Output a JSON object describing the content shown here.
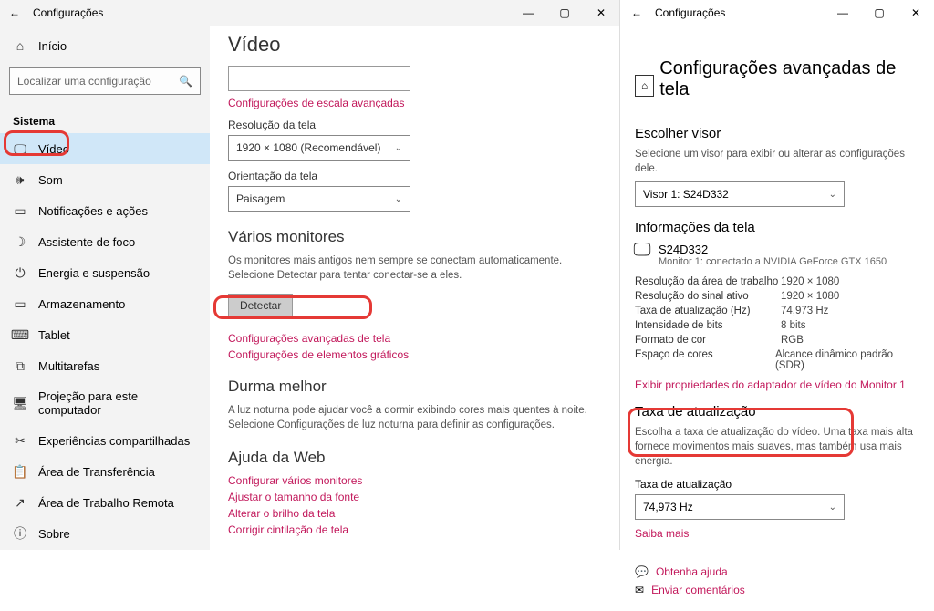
{
  "leftWindow": {
    "title": "Configurações",
    "home": "Início",
    "searchPlaceholder": "Localizar uma configuração",
    "sectionLabel": "Sistema",
    "nav": [
      {
        "label": "Vídeo",
        "icon": "🖵"
      },
      {
        "label": "Som",
        "icon": "🔊"
      },
      {
        "label": "Notificações e ações",
        "icon": "💬"
      },
      {
        "label": "Assistente de foco",
        "icon": "🌙"
      },
      {
        "label": "Energia e suspensão",
        "icon": "⏻"
      },
      {
        "label": "Armazenamento",
        "icon": "▭"
      },
      {
        "label": "Tablet",
        "icon": "⌨"
      },
      {
        "label": "Multitarefas",
        "icon": "⧉"
      },
      {
        "label": "Projeção para este computador",
        "icon": "🖥"
      },
      {
        "label": "Experiências compartilhadas",
        "icon": "⚙"
      },
      {
        "label": "Área de Transferência",
        "icon": "📋"
      },
      {
        "label": "Área de Trabalho Remota",
        "icon": "🖧"
      },
      {
        "label": "Sobre",
        "icon": "ⓘ"
      }
    ],
    "content": {
      "heading": "Vídeo",
      "advScaleLink": "Configurações de escala avançadas",
      "resLabel": "Resolução da tela",
      "resValue": "1920 × 1080 (Recomendável)",
      "orientLabel": "Orientação da tela",
      "orientValue": "Paisagem",
      "multiHeading": "Vários monitores",
      "multiDesc": "Os monitores mais antigos nem sempre se conectam automaticamente. Selecione Detectar para tentar conectar-se a eles.",
      "detectBtn": "Detectar",
      "advDisplayLink": "Configurações avançadas de tela",
      "graphicsLink": "Configurações de elementos gráficos",
      "sleepHeading": "Durma melhor",
      "sleepDesc": "A luz noturna pode ajudar você a dormir exibindo cores mais quentes à noite. Selecione Configurações de luz noturna para definir as configurações.",
      "webHeading": "Ajuda da Web",
      "webLinks": [
        "Configurar vários monitores",
        "Ajustar o tamanho da fonte",
        "Alterar o brilho da tela",
        "Corrigir cintilação de tela"
      ]
    }
  },
  "rightWindow": {
    "title": "Configurações",
    "heading": "Configurações avançadas de tela",
    "chooseDisplay": "Escolher visor",
    "chooseDesc": "Selecione um visor para exibir ou alterar as configurações dele.",
    "displaySelect": "Visor 1: S24D332",
    "infoHeading": "Informações da tela",
    "monitorName": "S24D332",
    "monitorSub": "Monitor 1: conectado a NVIDIA GeForce GTX 1650",
    "info": [
      {
        "k": "Resolução da área de trabalho",
        "v": "1920 × 1080"
      },
      {
        "k": "Resolução do sinal ativo",
        "v": "1920 × 1080"
      },
      {
        "k": "Taxa de atualização (Hz)",
        "v": "74,973 Hz"
      },
      {
        "k": "Intensidade de bits",
        "v": "8 bits"
      },
      {
        "k": "Formato de cor",
        "v": "RGB"
      },
      {
        "k": "Espaço de cores",
        "v": "Alcance dinâmico padrão (SDR)"
      }
    ],
    "adapterLink": "Exibir propriedades do adaptador de vídeo do Monitor 1",
    "refreshHeading": "Taxa de atualização",
    "refreshDesc": "Escolha a taxa de atualização do vídeo. Uma taxa mais alta fornece movimentos mais suaves, mas também usa mais energia.",
    "refreshLabel": "Taxa de atualização",
    "refreshValue": "74,973 Hz",
    "learnMore": "Saiba mais",
    "getHelp": "Obtenha ajuda",
    "feedback": "Enviar comentários"
  }
}
